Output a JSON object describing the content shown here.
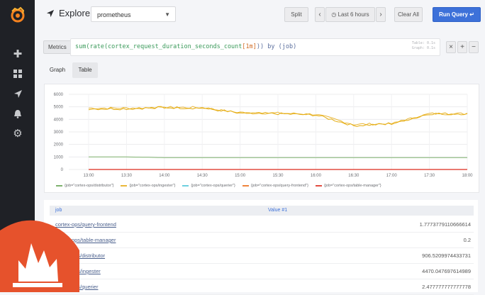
{
  "topbar": {
    "title": "Explore",
    "datasource": "prometheus",
    "split_label": "Split",
    "time_range_label": "Last 6 hours",
    "clear_all_label": "Clear All",
    "run_query_label": "Run Query"
  },
  "query": {
    "metrics_label": "Metrics",
    "fn_part": "sum(rate(",
    "metric_part": "cortex_request_duration_seconds_count",
    "range_part": "[1m]",
    "tail_part": ")) by (job)",
    "hint_line1": "Table: 0.1s",
    "hint_line2": "Graph: 0.1s"
  },
  "tabs": [
    {
      "label": "Graph"
    },
    {
      "label": "Table"
    }
  ],
  "colors": {
    "distributor": "#7eb26d",
    "ingester": "#eab839",
    "querier": "#6ed0e0",
    "query_frontend": "#e5ac0e",
    "table_manager": "#e24d42"
  },
  "chart_data": {
    "type": "line",
    "y_ticks": [
      "6000",
      "5000",
      "4000",
      "3000",
      "2000",
      "1000",
      "0"
    ],
    "ylim": [
      0,
      6000
    ],
    "x_ticks": [
      "13:00",
      "13:30",
      "14:00",
      "14:30",
      "15:00",
      "15:30",
      "16:00",
      "16:30",
      "17:00",
      "17:30",
      "18:00"
    ],
    "grid": true,
    "legend_position": "bottom",
    "series": [
      {
        "name": "{job=\"cortex-ops/distributor\"}",
        "values": [
          1000,
          1000,
          950,
          950,
          950,
          950,
          950,
          950,
          950,
          950,
          950
        ]
      },
      {
        "name": "{job=\"cortex-ops/ingester\"}",
        "values": [
          4900,
          4900,
          4950,
          4950,
          4500,
          4500,
          4400,
          3600,
          3650,
          4450,
          4450
        ]
      },
      {
        "name": "{job=\"cortex-ops/querier\"}",
        "values": [
          0,
          0,
          0,
          0,
          0,
          0,
          0,
          0,
          0,
          0,
          0
        ]
      },
      {
        "name": "{job=\"cortex-ops/query-frontend\"}",
        "values": [
          4850,
          4850,
          4950,
          4900,
          4500,
          4450,
          4350,
          3500,
          3650,
          4450,
          4450
        ]
      },
      {
        "name": "{job=\"cortex-ops/table-manager\"}",
        "values": [
          0,
          0,
          0,
          0,
          0,
          0,
          0,
          0,
          0,
          0,
          0
        ]
      }
    ]
  },
  "legend": [
    {
      "label": "{job=\"cortex-ops/distributor\"}",
      "color": "#7eb26d"
    },
    {
      "label": "{job=\"cortex-ops/ingester\"}",
      "color": "#eab839"
    },
    {
      "label": "{job=\"cortex-ops/querier\"}",
      "color": "#6ed0e0"
    },
    {
      "label": "{job=\"cortex-ops/query-frontend\"}",
      "color": "#ef843c"
    },
    {
      "label": "{job=\"cortex-ops/table-manager\"}",
      "color": "#e24d42"
    }
  ],
  "table": {
    "col_job": "job",
    "col_value": "Value #1",
    "rows": [
      {
        "job": "cortex-ops/query-frontend",
        "value": "1.7773779110666614"
      },
      {
        "job": "cortex-ops/table-manager",
        "value": "0.2"
      },
      {
        "job": "cortex-ops/distributor",
        "value": "906.5209974433731"
      },
      {
        "job": "cortex-ops/ingester",
        "value": "4470.047697614989"
      },
      {
        "job": "cortex-ops/querier",
        "value": "2.477777777777778"
      }
    ]
  }
}
